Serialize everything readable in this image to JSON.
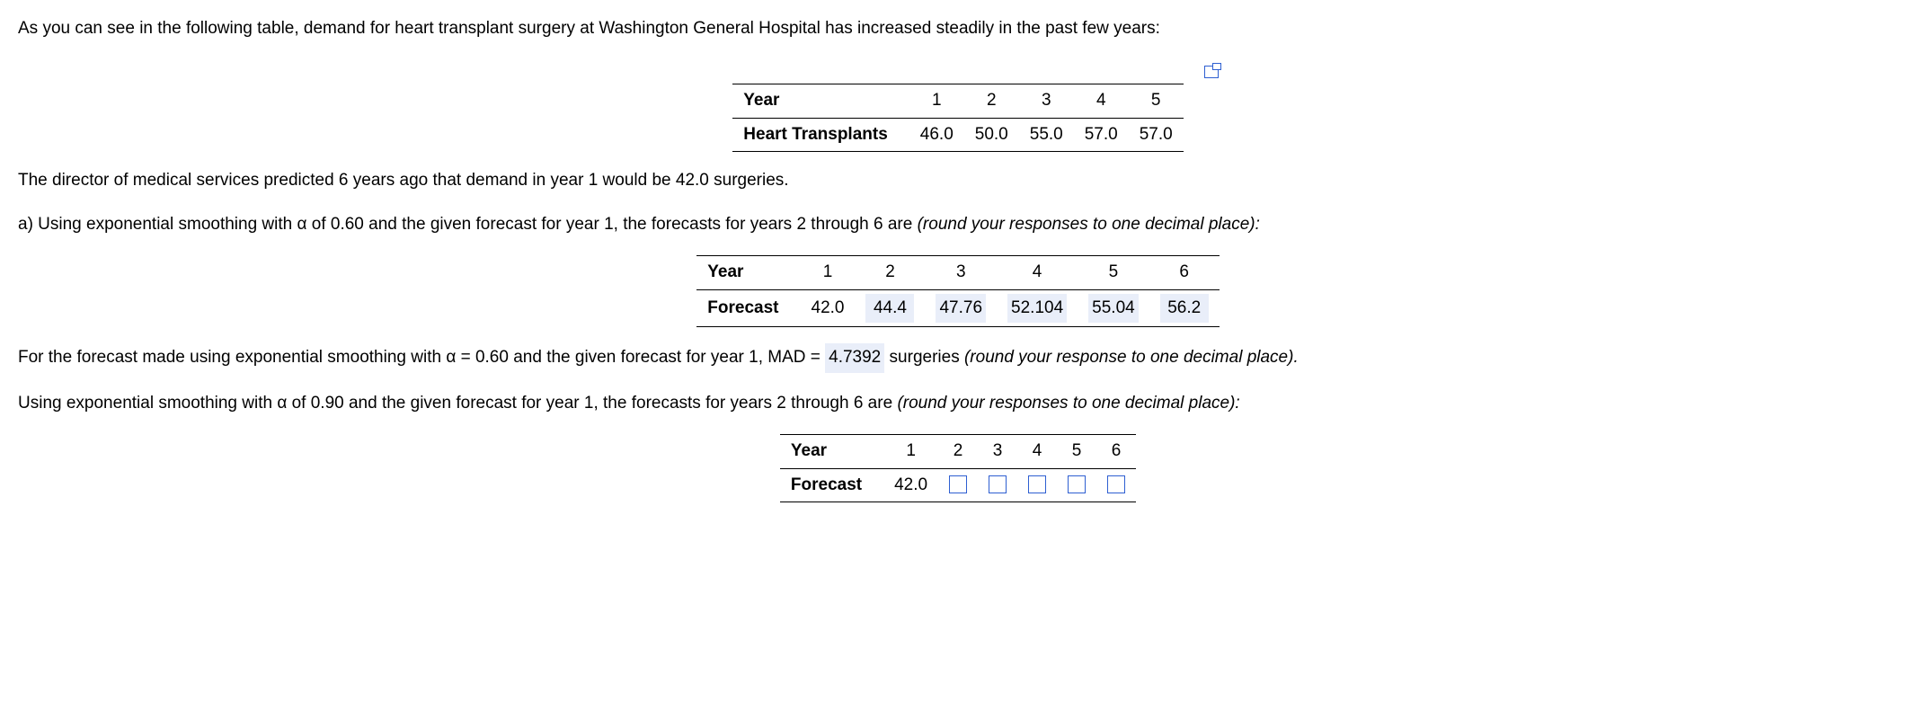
{
  "intro": "As you can see in the following table, demand for heart transplant surgery at Washington General Hospital has increased steadily in the past few years:",
  "table1": {
    "rowA_label": "Year",
    "rowA": [
      "1",
      "2",
      "3",
      "4",
      "5"
    ],
    "rowB_label": "Heart Transplants",
    "rowB": [
      "46.0",
      "50.0",
      "55.0",
      "57.0",
      "57.0"
    ]
  },
  "p2": "The director of medical services predicted 6 years ago that demand in year 1 would be 42.0 surgeries.",
  "p3_a": "a) Using exponential smoothing with α of 0.60 and the given forecast for year 1, the forecasts for years 2 through 6 are ",
  "p3_b": "(round your responses to one decimal place):",
  "table2": {
    "rowA_label": "Year",
    "rowA": [
      "1",
      "2",
      "3",
      "4",
      "5",
      "6"
    ],
    "rowB_label": "Forecast",
    "rowB": [
      "42.0",
      "44.4",
      "47.76",
      "52.104",
      "55.04",
      "56.2"
    ]
  },
  "p4_a": "For the forecast made using exponential smoothing with α = 0.60 and the given forecast for year 1, MAD = ",
  "p4_val": "4.7392",
  "p4_b": " surgeries ",
  "p4_c": "(round your response to one decimal place).",
  "p5_a": "Using exponential smoothing with α of 0.90 and the given forecast for year 1, the forecasts for years 2 through 6 are ",
  "p5_b": "(round your responses to one decimal place):",
  "table3": {
    "rowA_label": "Year",
    "rowA": [
      "1",
      "2",
      "3",
      "4",
      "5",
      "6"
    ],
    "rowB_label": "Forecast",
    "rowB_first": "42.0"
  }
}
